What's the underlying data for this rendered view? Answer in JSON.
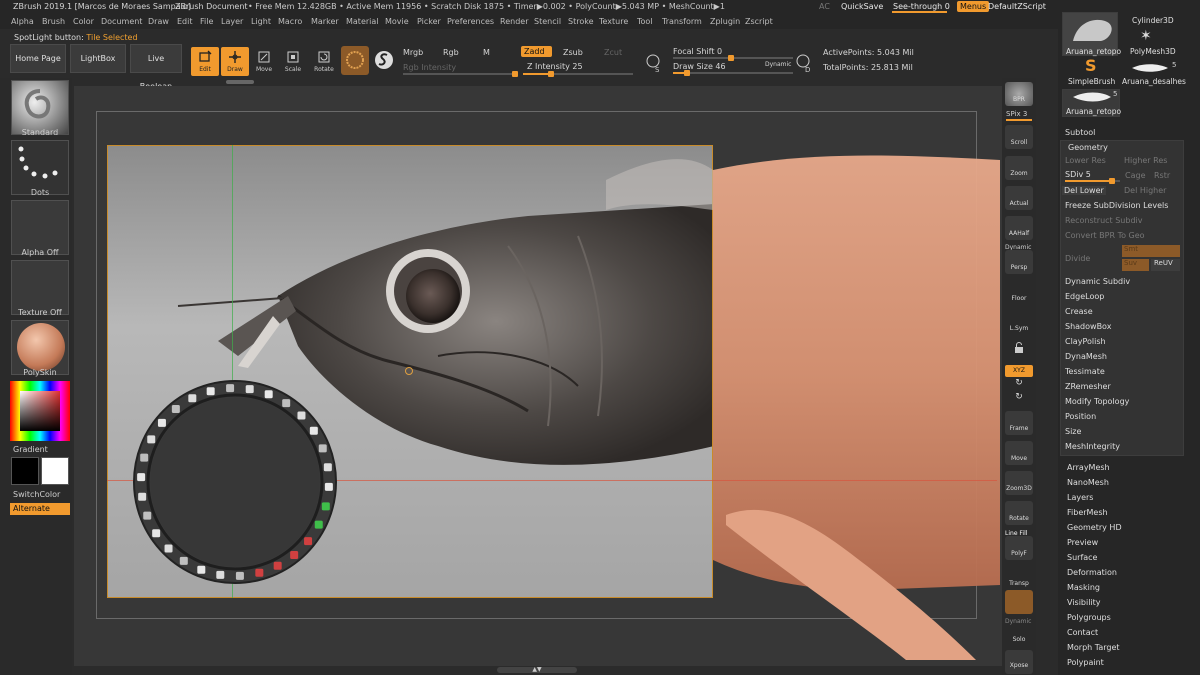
{
  "titlebar": {
    "app": "ZBrush 2019.1 [Marcos de Moraes Sampaio]",
    "doc": "ZBrush Document",
    "stats": "• Free Mem 12.428GB • Active Mem 11956 • Scratch Disk 1875 • Timer▶0.002 • PolyCount▶5.043 MP • MeshCount▶1",
    "ac": "AC",
    "quicksave": "QuickSave",
    "see_through": "See-through  0",
    "menus": "Menus",
    "default_zscript": "DefaultZScript"
  },
  "menu": [
    "Alpha",
    "Brush",
    "Color",
    "Document",
    "Draw",
    "Edit",
    "File",
    "Layer",
    "Light",
    "Macro",
    "Marker",
    "Material",
    "Movie",
    "Picker",
    "Preferences",
    "Render",
    "Stencil",
    "Stroke",
    "Texture",
    "Tool",
    "Transform",
    "Zplugin",
    "Zscript"
  ],
  "spotlight": {
    "label": "SpotLight button: ",
    "value": "Tile Selected"
  },
  "toolbar": {
    "home": "Home Page",
    "lightbox": "LightBox",
    "live_boolean": "Live Boolean",
    "edit": "Edit",
    "draw": "Draw",
    "move": "Move",
    "scale": "Scale",
    "rotate": "Rotate",
    "mrgb": "Mrgb",
    "rgb": "Rgb",
    "m": "M",
    "rgb_intensity": "Rgb Intensity",
    "zadd": "Zadd",
    "zsub": "Zsub",
    "zcut": "Zcut",
    "z_intensity_label": "Z Intensity",
    "z_intensity": "25",
    "focal_shift": "Focal Shift 0",
    "draw_size": "Draw Size 46",
    "dynamic": "Dynamic",
    "active_points": "ActivePoints: 5.043 Mil",
    "total_points": "TotalPoints: 25.813 Mil",
    "z_intensity_level": 0.25,
    "draw_size_level": 0.12
  },
  "left_shelf": {
    "standard": "Standard",
    "dots": "Dots",
    "alpha_off": "Alpha Off",
    "texture_off": "Texture Off",
    "polyskin": "PolySkin",
    "gradient": "Gradient",
    "switchcolor": "SwitchColor",
    "alternate": "Alternate"
  },
  "right_shelf": {
    "bpr": "BPR",
    "spix": "SPix 3",
    "scroll": "Scroll",
    "zoom": "Zoom",
    "actual": "Actual",
    "aahalf": "AAHalf",
    "dynamic": "Dynamic",
    "persp": "Persp",
    "floor": "Floor",
    "lsym": "L.Sym",
    "xyz": "XYZ",
    "frame": "Frame",
    "move": "Move",
    "zoom3d": "Zoom3D",
    "rotate": "Rotate",
    "linefill": "Line Fill",
    "polyf": "PolyF",
    "transp": "Transp",
    "dynamic2": "Dynamic",
    "solo": "Solo",
    "xpose": "Xpose"
  },
  "tool_panel": {
    "thumbs": [
      {
        "label": "Aruana_retopo"
      },
      {
        "label": "Cylinder3D"
      },
      {
        "label": "PolyMesh3D"
      },
      {
        "label": "SimpleBrush"
      },
      {
        "label": "Aruana_desalhes",
        "count": "5"
      },
      {
        "label": "Aruana_retopo",
        "count": "5"
      }
    ],
    "subtool": "Subtool",
    "geometry": "Geometry",
    "lower_res": "Lower Res",
    "higher_res": "Higher Res",
    "sdiv": "SDiv 5",
    "cage": "Cage",
    "rstr": "Rstr",
    "del_lower": "Del Lower",
    "del_higher": "Del Higher",
    "freeze": "Freeze SubDivision Levels",
    "reconstruct": "Reconstruct Subdiv",
    "convert_bpr": "Convert BPR To Geo",
    "divide": "Divide",
    "smt": "Smt",
    "suv": "Suv",
    "reuv": "ReUV",
    "sub_items": [
      "Dynamic Subdiv",
      "EdgeLoop",
      "Crease",
      "ShadowBox",
      "ClayPolish",
      "DynaMesh",
      "Tessimate",
      "ZRemesher",
      "Modify Topology",
      "Position",
      "Size",
      "MeshIntegrity"
    ],
    "sections": [
      "ArrayMesh",
      "NanoMesh",
      "Layers",
      "FiberMesh",
      "Geometry HD",
      "Preview",
      "Surface",
      "Deformation",
      "Masking",
      "Visibility",
      "Polygroups",
      "Contact",
      "Morph Target",
      "Polypaint"
    ],
    "sdiv_level": 0.85
  }
}
